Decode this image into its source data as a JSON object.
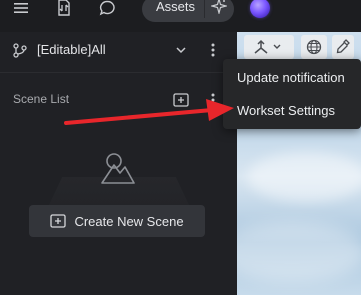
{
  "topbar": {
    "assets_label": "Assets",
    "icons": [
      "menu-icon",
      "file-sync-icon",
      "chat-bubble-icon",
      "sparkle-icon",
      "ai-orb-icon"
    ]
  },
  "panel": {
    "branch_label": "[Editable]All",
    "scene_list_label": "Scene List",
    "create_button_label": "Create New Scene"
  },
  "viewport": {
    "toolbar_icons": [
      "transform-axis-icon",
      "globe-icon",
      "eyedropper-icon"
    ]
  },
  "context_menu": {
    "items": [
      {
        "label": "Update notification"
      },
      {
        "label": "Workset Settings"
      }
    ]
  },
  "annotation": {
    "arrow_color": "#e8262b"
  },
  "colors": {
    "background": "#1e1f22",
    "panel": "#202125",
    "button": "#33353a",
    "menu": "#262729",
    "arrow": "#e8262b"
  }
}
